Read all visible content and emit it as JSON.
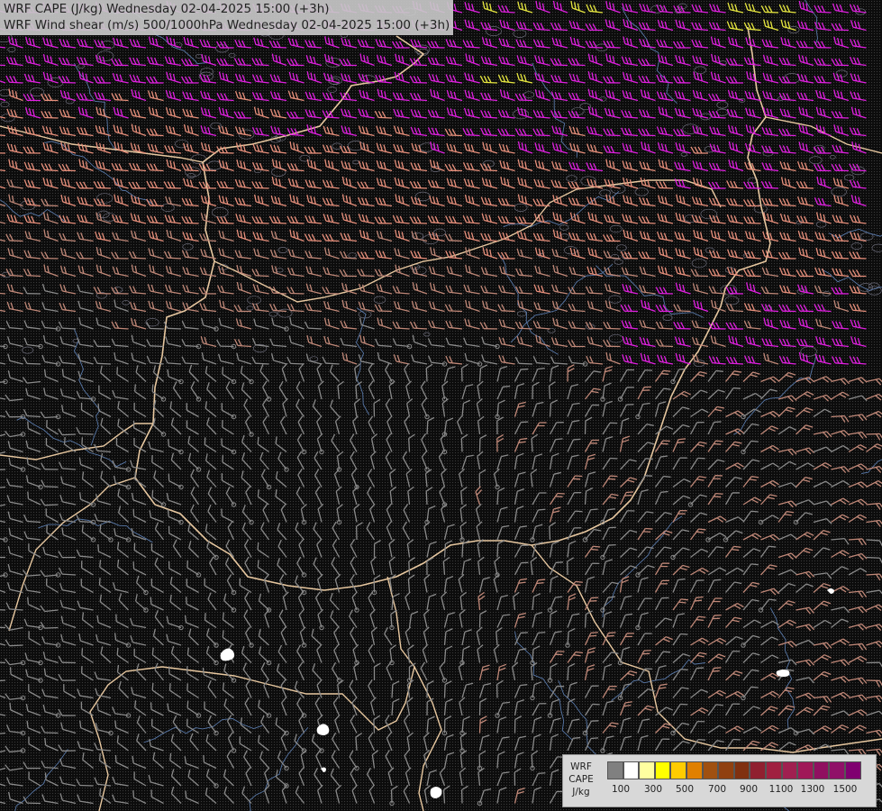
{
  "titles": {
    "line1": "WRF CAPE (J/kg) Wednesday 02-04-2025 15:00 (+3h)",
    "line2": "WRF Wind shear (m/s) 500/1000hPa Wednesday 02-04-2025 15:00 (+3h)"
  },
  "legend": {
    "line1": "WRF",
    "line2": "CAPE",
    "line3": "J/kg",
    "colors": [
      "#808080",
      "#ffffff",
      "#ffffa0",
      "#ffff00",
      "#ffcc00",
      "#e08000",
      "#a05010",
      "#904010",
      "#803010",
      "#902030",
      "#a02040",
      "#a02050",
      "#a01858",
      "#901060",
      "#901068",
      "#800070"
    ],
    "ticks": [
      "100",
      "300",
      "500",
      "700",
      "900",
      "1100",
      "1300",
      "1500"
    ]
  },
  "colors": {
    "barb_weak": "#8a8a8a",
    "barb_mid": "#c08878",
    "barb_strong": "#e8907c",
    "barb_magenta": "#e020e0",
    "barb_yellow": "#e8e840",
    "border": "#e8c8a0",
    "river": "#5878a8"
  }
}
